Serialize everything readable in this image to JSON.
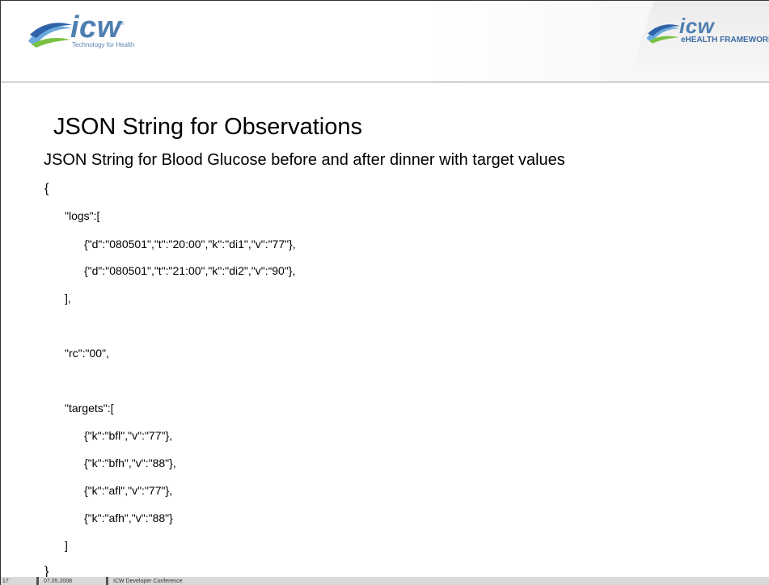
{
  "header": {
    "left_logo": {
      "word": "icw",
      "reg_mark": "®",
      "tagline": "Technology for Health"
    },
    "right_logo": {
      "word": "icw",
      "tagline": "eHEALTH FRAMEWORK"
    }
  },
  "slide": {
    "title": "JSON String for Observations",
    "subtitle": "JSON String for Blood Glucose before and after dinner with target values",
    "code_lines": [
      "{",
      "\"logs\":[",
      "{\"d\":\"080501\",\"t\":\"20:00\",\"k\":\"di1\",\"v\":\"77\"},",
      "{\"d\":\"080501\",\"t\":\"21:00\",\"k\":\"di2\",\"v\":“90\"},",
      "],",
      "\"rc\":\"00\",",
      "\"targets\":[",
      "{\"k\":\"bfl\",\"v\":\"77\"},",
      "{\"k\":\"bfh\",\"v\":\"88\"},",
      "{\"k\":\"afl\",\"v\":\"77\"},",
      "{\"k\":\"afh\",\"v\":\"88\"}",
      "]",
      "}"
    ]
  },
  "footer": {
    "page_number": "17",
    "date": "07.05.2008",
    "event": "ICW Developer Conference"
  },
  "colors": {
    "logo_blue": "#4f7fb1",
    "swoosh_light": "#6aa8dc",
    "swoosh_green": "#7ac143",
    "footer_bg": "#d9d9d9"
  }
}
